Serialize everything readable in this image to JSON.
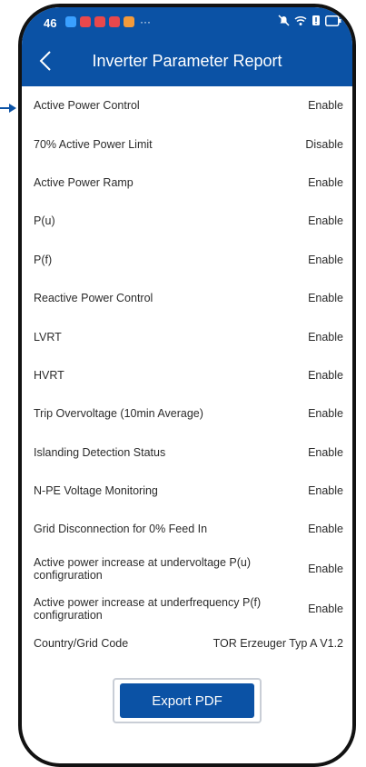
{
  "status_bar": {
    "time": "46",
    "notification_more": "···",
    "notification_colors": [
      "#3aa0ff",
      "#e8484c",
      "#e8484c",
      "#e8484c",
      "#f29a3b"
    ],
    "icons": [
      "mute-icon",
      "wifi-icon",
      "sim-icon",
      "battery-icon"
    ]
  },
  "header": {
    "back_icon": "chevron-left-icon",
    "title": "Inverter Parameter Report"
  },
  "parameters": [
    {
      "label": "Active Power Control",
      "value": "Enable"
    },
    {
      "label": "70% Active Power Limit",
      "value": "Disable"
    },
    {
      "label": "Active Power Ramp",
      "value": "Enable"
    },
    {
      "label": "P(u)",
      "value": "Enable"
    },
    {
      "label": "P(f)",
      "value": "Enable"
    },
    {
      "label": "Reactive Power Control",
      "value": "Enable"
    },
    {
      "label": "LVRT",
      "value": "Enable"
    },
    {
      "label": "HVRT",
      "value": "Enable"
    },
    {
      "label": "Trip Overvoltage (10min Average)",
      "value": "Enable"
    },
    {
      "label": "Islanding Detection Status",
      "value": "Enable"
    },
    {
      "label": "N-PE Voltage Monitoring",
      "value": "Enable"
    },
    {
      "label": "Grid Disconnection for 0% Feed In",
      "value": "Enable"
    },
    {
      "label": "Active power increase at undervoltage P(u) configruration",
      "value": "Enable"
    },
    {
      "label": "Active power increase at underfrequency P(f) configruration",
      "value": "Enable"
    }
  ],
  "country": {
    "label": "Country/Grid Code",
    "value": "TOR Erzeuger Typ A V1.2"
  },
  "actions": {
    "export_label": "Export PDF"
  },
  "colors": {
    "primary": "#0b52a5",
    "text": "#2b2b2b",
    "pointer": "#0b52a5"
  }
}
